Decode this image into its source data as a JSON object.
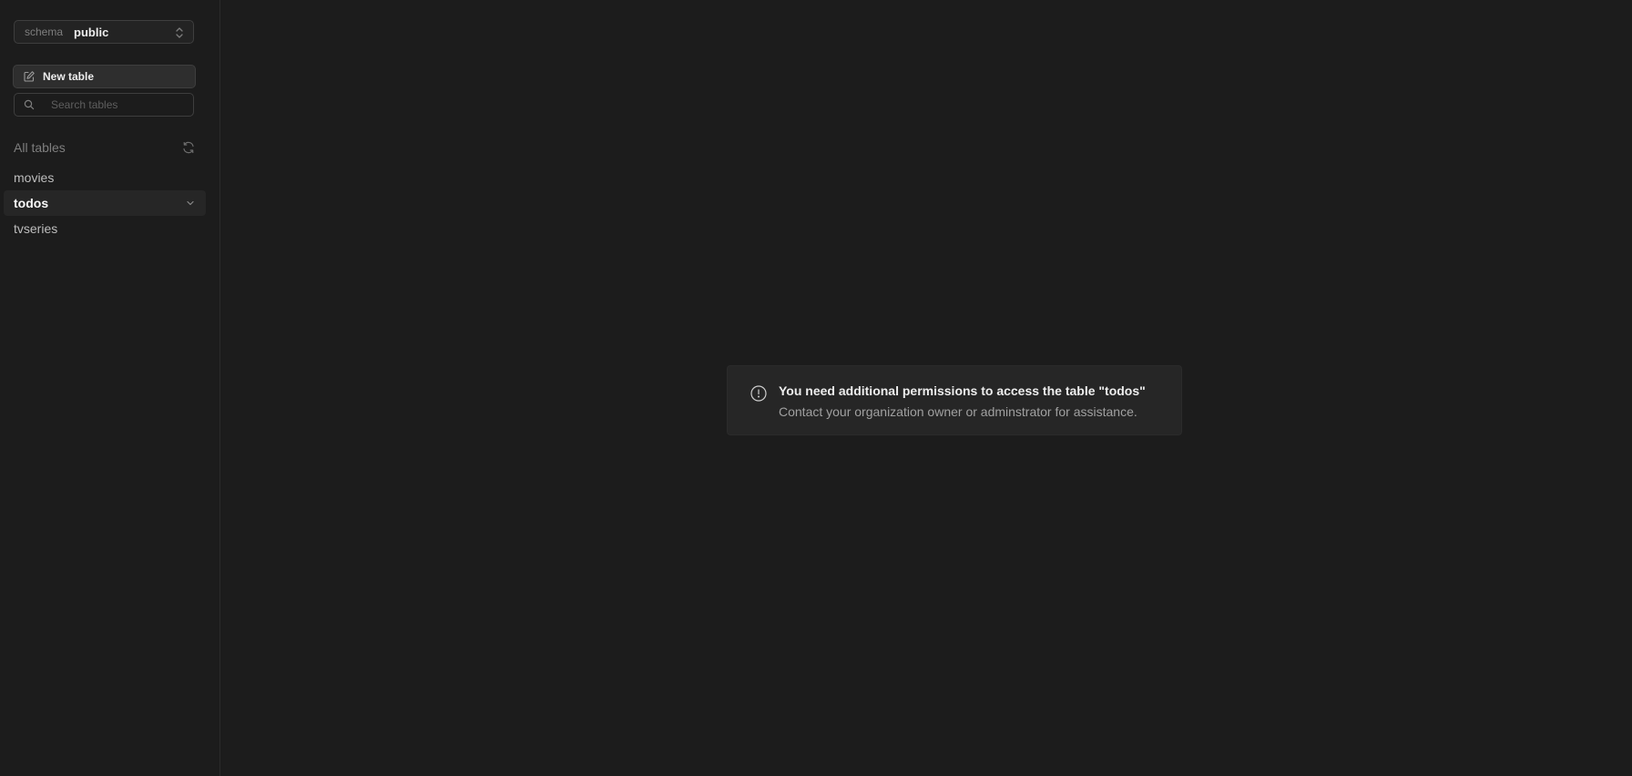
{
  "sidebar": {
    "schema": {
      "label": "schema",
      "value": "public"
    },
    "new_table_label": "New table",
    "search": {
      "placeholder": "Search tables",
      "value": ""
    },
    "tables_header": "All tables",
    "tables": [
      {
        "name": "movies",
        "active": false
      },
      {
        "name": "todos",
        "active": true
      },
      {
        "name": "tvseries",
        "active": false
      }
    ]
  },
  "main": {
    "notice": {
      "title": "You need additional permissions to access the table \"todos\"",
      "body": "Contact your organization owner or adminstrator for assistance."
    }
  },
  "colors": {
    "background": "#1c1c1c",
    "panel": "#262626",
    "border": "#3e3e3e",
    "text_primary": "#ededed",
    "text_muted": "#7e7e7e"
  },
  "icons": {
    "schema_chevrons": "chevron-up-down-icon",
    "new_table": "edit-icon",
    "search": "search-icon",
    "refresh": "refresh-icon",
    "active_table_chevron": "chevron-down-icon",
    "notice": "info-icon"
  }
}
